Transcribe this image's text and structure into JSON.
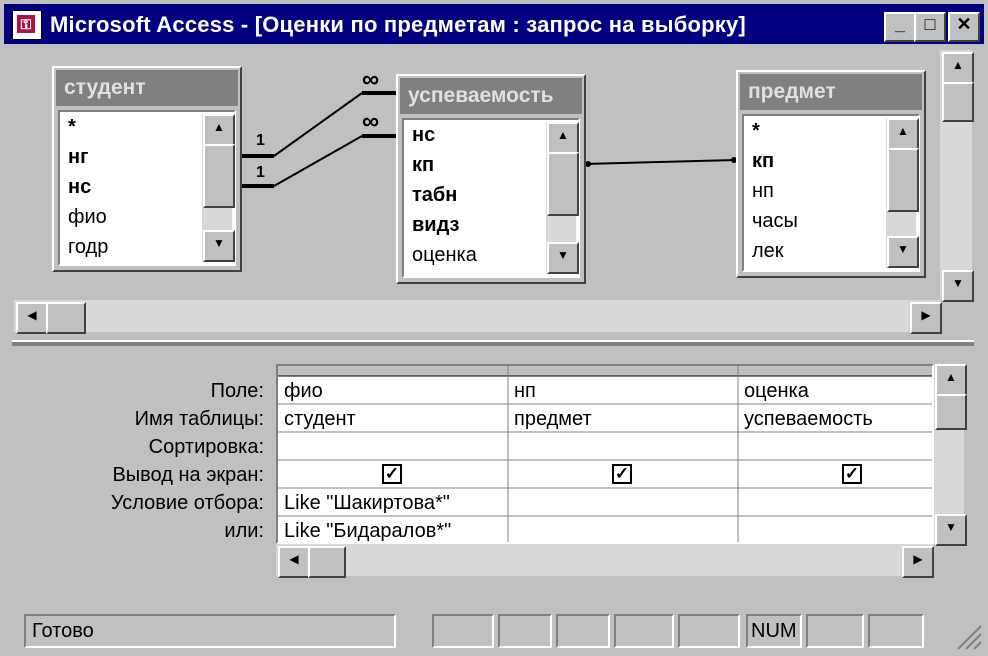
{
  "window": {
    "app_name": "Microsoft Access",
    "separator": " - ",
    "doc_title": "[Оценки по предметам : запрос на выборку]",
    "buttons": {
      "minimize": "_",
      "maximize": "□",
      "close": "✕"
    }
  },
  "tables": [
    {
      "name": "студент",
      "fields": [
        {
          "label": "*",
          "bold": true
        },
        {
          "label": "нг",
          "bold": true
        },
        {
          "label": "нс",
          "bold": true
        },
        {
          "label": "фио",
          "bold": false
        },
        {
          "label": "годр",
          "bold": false
        }
      ]
    },
    {
      "name": "успеваемость",
      "fields": [
        {
          "label": "нс",
          "bold": true
        },
        {
          "label": "кп",
          "bold": true
        },
        {
          "label": "табн",
          "bold": true
        },
        {
          "label": "видз",
          "bold": true
        },
        {
          "label": "оценка",
          "bold": false
        }
      ]
    },
    {
      "name": "предмет",
      "fields": [
        {
          "label": "*",
          "bold": true
        },
        {
          "label": "кп",
          "bold": true
        },
        {
          "label": "нп",
          "bold": false
        },
        {
          "label": "часы",
          "bold": false
        },
        {
          "label": "лек",
          "bold": false
        }
      ]
    }
  ],
  "relations": {
    "one_1": "1",
    "one_2": "1",
    "many_1": "∞",
    "many_2": "∞"
  },
  "grid": {
    "row_labels": [
      "Поле:",
      "Имя таблицы:",
      "Сортировка:",
      "Вывод на экран:",
      "Условие отбора:",
      "или:"
    ],
    "columns": [
      {
        "field": "фио",
        "table": "студент",
        "sort": "",
        "show": true,
        "criteria": "Like \"Шакиртова*\"",
        "or": "Like \"Бидаралов*\""
      },
      {
        "field": "нп",
        "table": "предмет",
        "sort": "",
        "show": true,
        "criteria": "",
        "or": ""
      },
      {
        "field": "оценка",
        "table": "успеваемость",
        "sort": "",
        "show": true,
        "criteria": "",
        "or": ""
      }
    ]
  },
  "status": {
    "text": "Готово",
    "num": "NUM"
  },
  "glyphs": {
    "up": "▲",
    "down": "▼",
    "left": "◀",
    "right": "▶",
    "check": "✓"
  }
}
